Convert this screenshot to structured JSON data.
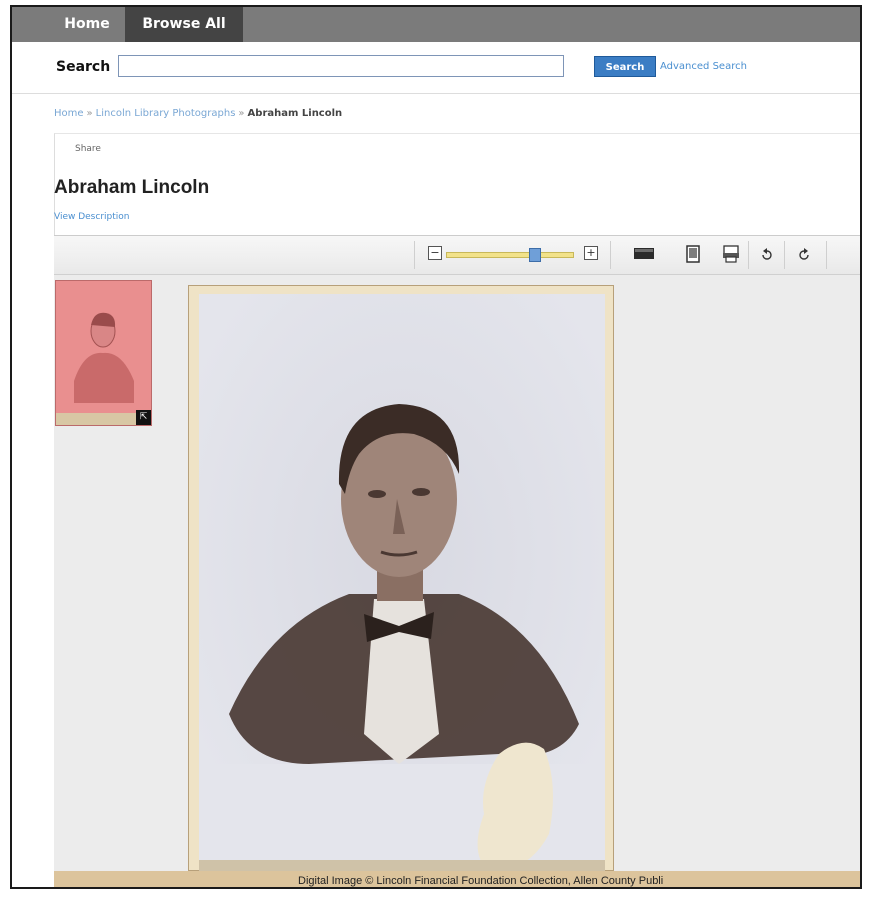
{
  "nav": {
    "home": "Home",
    "browse_all": "Browse All"
  },
  "search": {
    "label": "Search",
    "value": "",
    "button": "Search",
    "advanced": "Advanced Search"
  },
  "breadcrumb": {
    "home": "Home",
    "sep": "»",
    "collection": "Lincoln Library Photographs",
    "current": "Abraham Lincoln"
  },
  "item": {
    "share": "Share",
    "title": "Abraham Lincoln",
    "view_description": "View Description"
  },
  "toolbar": {
    "zoom_out": "−",
    "zoom_in": "+",
    "zoom_level": 0.72,
    "icons": [
      "fit-width-icon",
      "fit-page-icon",
      "print-icon",
      "rotate-left-icon",
      "rotate-right-icon"
    ]
  },
  "viewer": {
    "thumbnail_expand": "⇱"
  },
  "credit": "Digital Image © Lincoln Financial Foundation Collection, Allen County Publi",
  "colors": {
    "nav_bg": "#7b7b7b",
    "search_button": "#3b7dc4",
    "link": "#4a8fd0",
    "thumb_highlight": "#e98f8f"
  }
}
